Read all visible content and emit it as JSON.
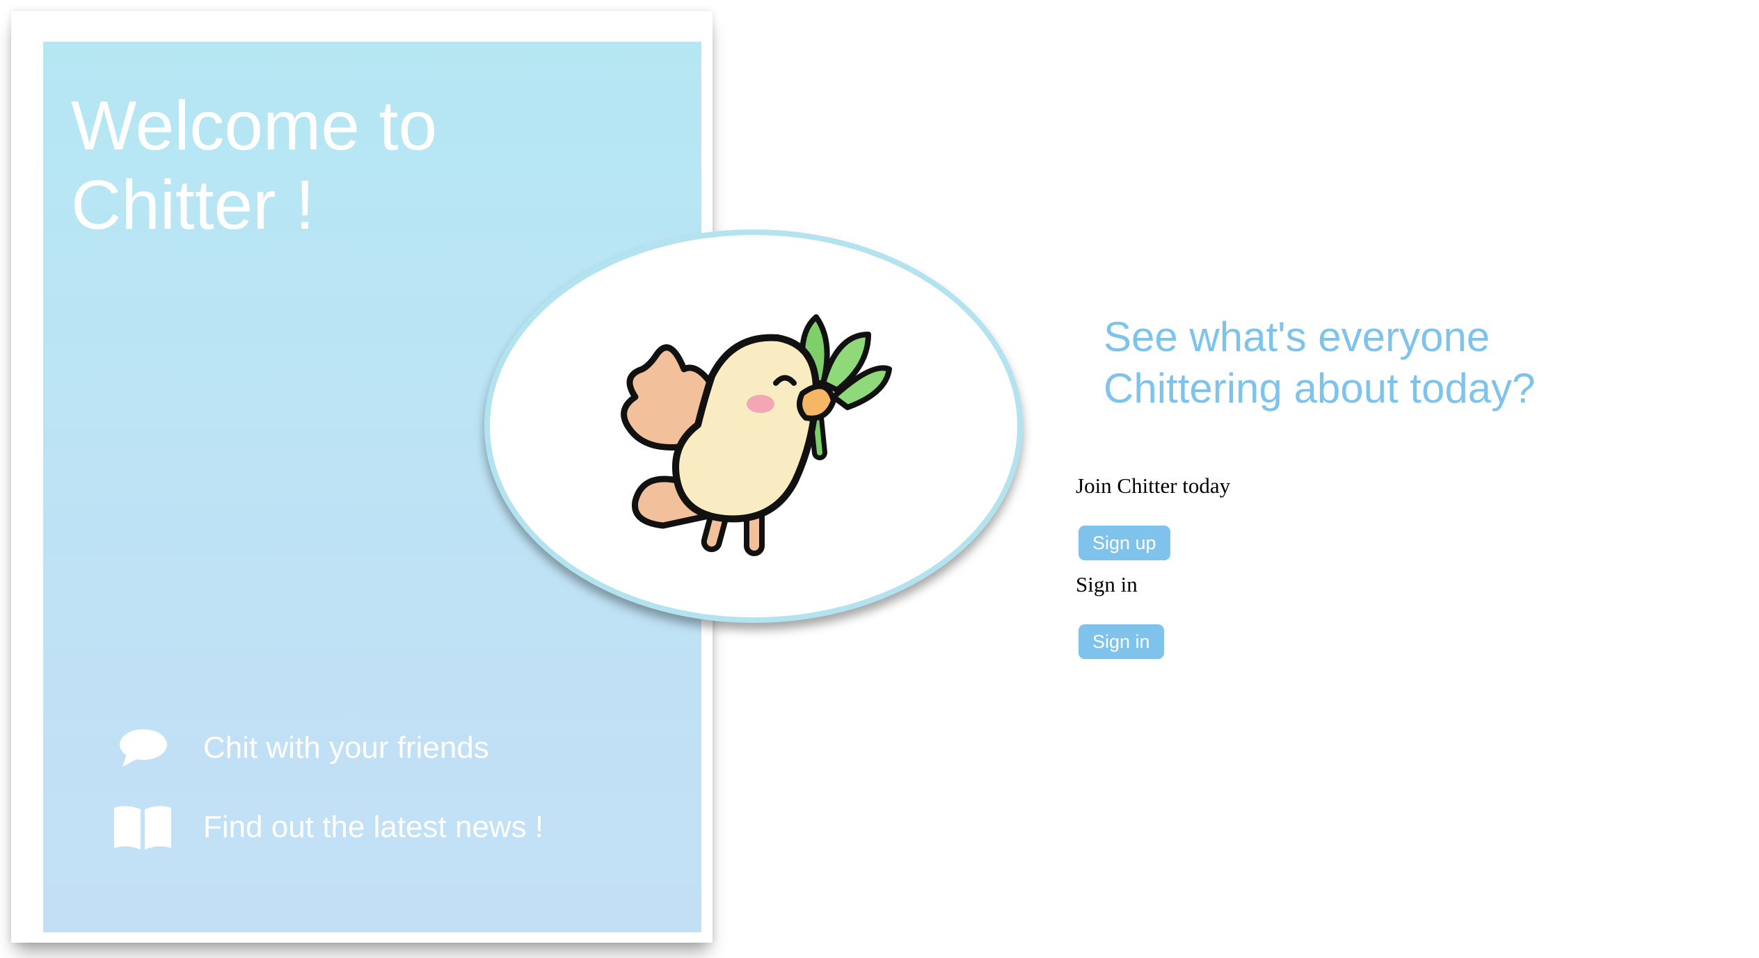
{
  "welcome": {
    "line1": "Welcome to",
    "line2": "Chitter !"
  },
  "features": [
    {
      "icon": "speech-bubble-icon",
      "label": "Chit with your friends"
    },
    {
      "icon": "open-book-icon",
      "label": "Find out the latest news !"
    }
  ],
  "mascot": {
    "icon": "bird-mascot-icon"
  },
  "tagline": {
    "line1": "See what's everyone",
    "line2": "Chittering about today?"
  },
  "join": {
    "label": "Join Chitter today",
    "button": "Sign up"
  },
  "signin": {
    "label": "Sign in",
    "button": "Sign in"
  },
  "colors": {
    "panel": "#b5e7f3",
    "accent": "#7fc2ec",
    "tagline": "#7ec3ec",
    "oval_border": "#b4e3f0"
  }
}
